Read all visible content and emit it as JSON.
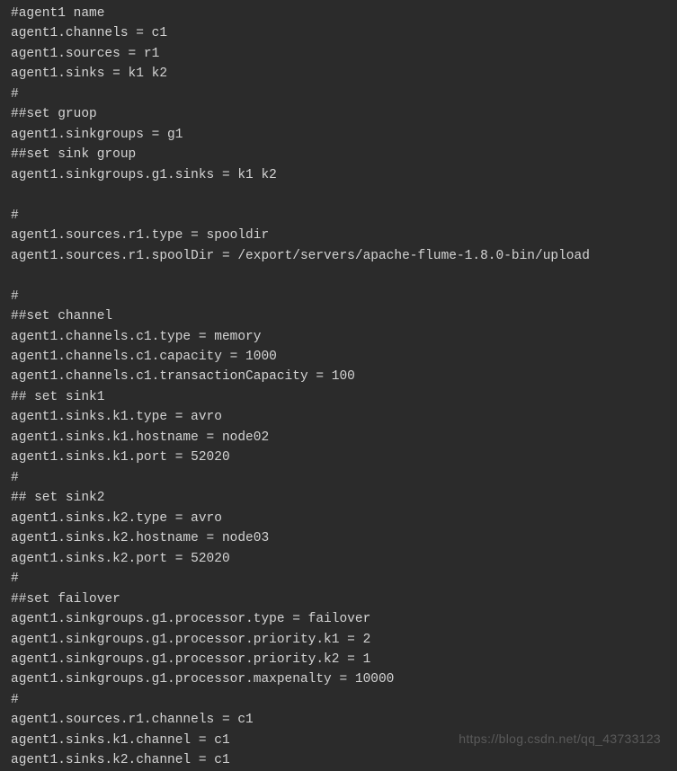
{
  "code_lines": [
    "#agent1 name",
    "agent1.channels = c1",
    "agent1.sources = r1",
    "agent1.sinks = k1 k2",
    "#",
    "##set gruop",
    "agent1.sinkgroups = g1",
    "##set sink group",
    "agent1.sinkgroups.g1.sinks = k1 k2",
    "",
    "#",
    "agent1.sources.r1.type = spooldir",
    "agent1.sources.r1.spoolDir = /export/servers/apache-flume-1.8.0-bin/upload",
    "",
    "#",
    "##set channel",
    "agent1.channels.c1.type = memory",
    "agent1.channels.c1.capacity = 1000",
    "agent1.channels.c1.transactionCapacity = 100",
    "## set sink1",
    "agent1.sinks.k1.type = avro",
    "agent1.sinks.k1.hostname = node02",
    "agent1.sinks.k1.port = 52020",
    "#",
    "## set sink2",
    "agent1.sinks.k2.type = avro",
    "agent1.sinks.k2.hostname = node03",
    "agent1.sinks.k2.port = 52020",
    "#",
    "##set failover",
    "agent1.sinkgroups.g1.processor.type = failover",
    "agent1.sinkgroups.g1.processor.priority.k1 = 2",
    "agent1.sinkgroups.g1.processor.priority.k2 = 1",
    "agent1.sinkgroups.g1.processor.maxpenalty = 10000",
    "#",
    "agent1.sources.r1.channels = c1",
    "agent1.sinks.k1.channel = c1",
    "agent1.sinks.k2.channel = c1"
  ],
  "watermark": "https://blog.csdn.net/qq_43733123"
}
